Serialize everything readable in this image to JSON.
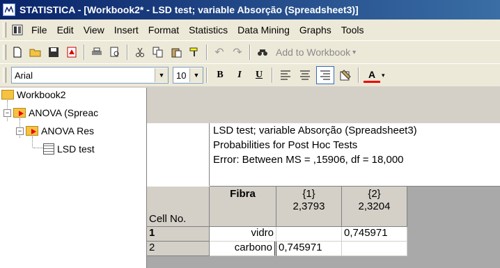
{
  "window": {
    "title": "STATISTICA - [Workbook2* - LSD test; variable Absorção (Spreadsheet3)]"
  },
  "menu": [
    "File",
    "Edit",
    "View",
    "Insert",
    "Format",
    "Statistics",
    "Data Mining",
    "Graphs",
    "Tools"
  ],
  "toolbar": {
    "add_to_workbook": "Add to Workbook"
  },
  "format_bar": {
    "font": "Arial",
    "font_size": "10"
  },
  "tree": {
    "root": "Workbook2",
    "anova_folder": "ANOVA (Spreac",
    "anova_results": "ANOVA Res",
    "lsd_sheet": "LSD test"
  },
  "sheet": {
    "header_lines": [
      "LSD test; variable Absorção (Spreadsheet3)",
      "Probabilities for Post Hoc Tests",
      "Error: Between MS = ,15906, df = 18,000"
    ],
    "cell_no_label": "Cell No.",
    "columns": [
      {
        "top": "Fibra",
        "bottom": ""
      },
      {
        "top": "{1}",
        "bottom": "2,3793"
      },
      {
        "top": "{2}",
        "bottom": "2,3204"
      }
    ],
    "rows": [
      {
        "num": "1",
        "fibra": "vidro",
        "c1": "",
        "c2": "0,745971"
      },
      {
        "num": "2",
        "fibra": "carbono",
        "c1": "0,745971",
        "c2": ""
      }
    ]
  }
}
